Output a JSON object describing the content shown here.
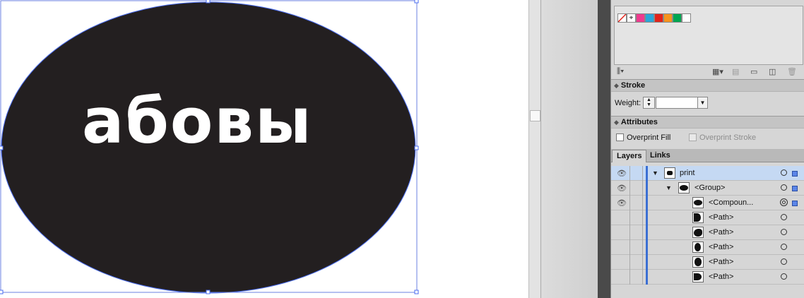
{
  "artwork": {
    "text": "абовы",
    "background_color": "#231f20",
    "text_color": "#ffffff",
    "selection_color": "#4a6cf0"
  },
  "swatches_panel": {
    "swatch_colors": [
      "#ffffff",
      "#ffffff",
      "#ef3a8e",
      "#2aa6d8",
      "#e2231a",
      "#f7941d",
      "#00a651",
      "#ffffff"
    ],
    "toolbar": {
      "library_icon": "swatch-libraries-icon",
      "grid_icon": "grid-view-icon",
      "new_folder_icon": "folder-icon",
      "new_swatch_icon": "new-swatch-icon",
      "delete_icon": "trash-icon"
    }
  },
  "stroke_panel": {
    "title": "Stroke",
    "weight_label": "Weight:",
    "weight_value": ""
  },
  "attributes_panel": {
    "title": "Attributes",
    "overprint_fill_label": "Overprint Fill",
    "overprint_stroke_label": "Overprint Stroke"
  },
  "layers_panel": {
    "tabs": [
      {
        "label": "Layers"
      },
      {
        "label": "Links"
      }
    ],
    "rows": [
      {
        "name": "print",
        "visible": true,
        "selected": true
      },
      {
        "name": "<Group>",
        "visible": true
      },
      {
        "name": "<Compoun...",
        "visible": true
      },
      {
        "name": "<Path>",
        "visible": false
      },
      {
        "name": "<Path>",
        "visible": false
      },
      {
        "name": "<Path>",
        "visible": false
      },
      {
        "name": "<Path>",
        "visible": false
      },
      {
        "name": "<Path>",
        "visible": false
      }
    ]
  }
}
